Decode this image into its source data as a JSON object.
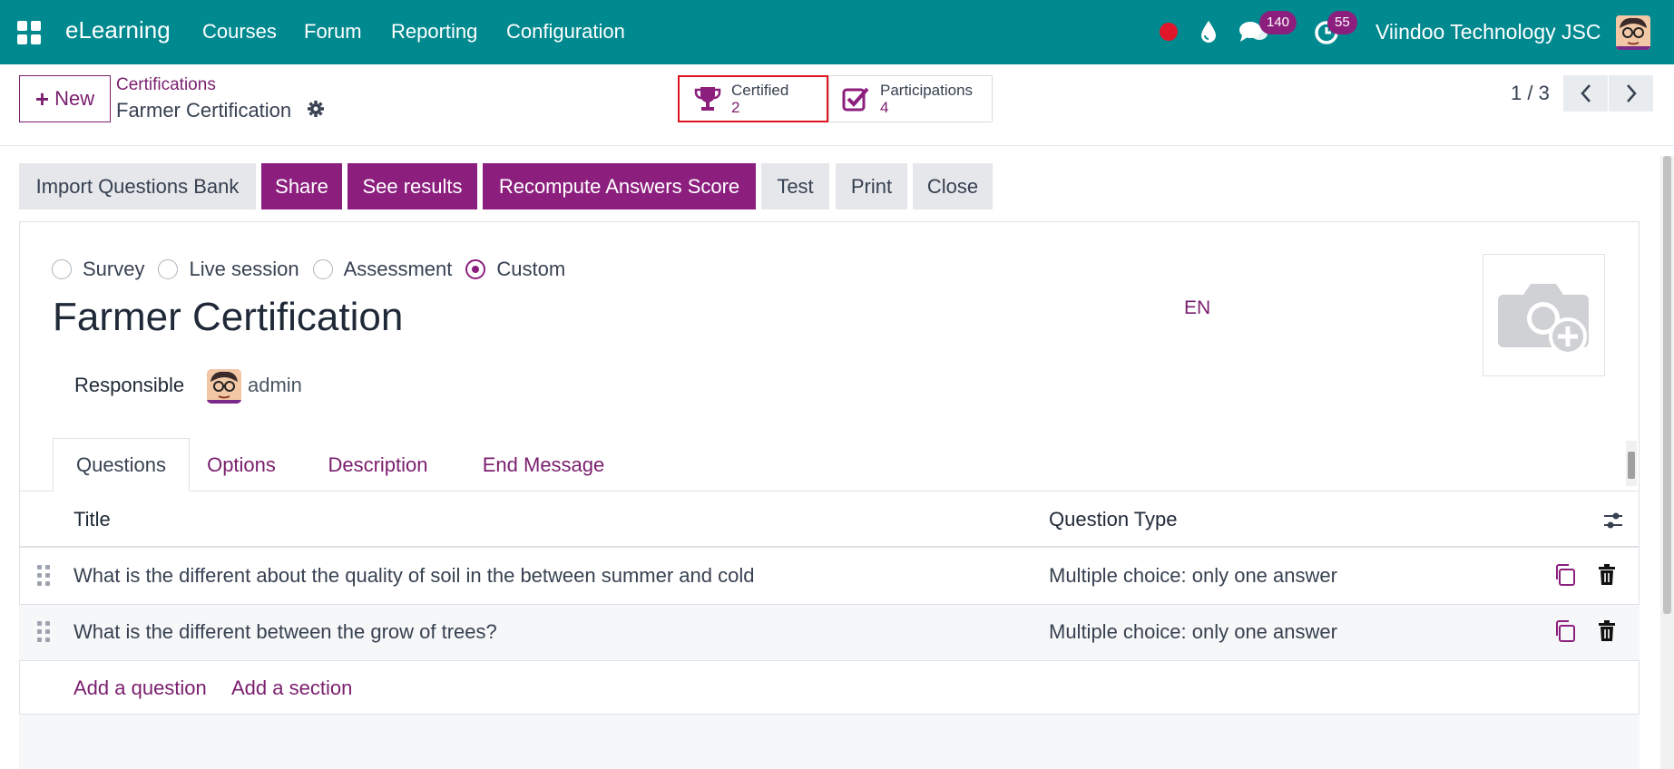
{
  "navbar": {
    "app_name": "eLearning",
    "menu": [
      "Courses",
      "Forum",
      "Reporting",
      "Configuration"
    ],
    "messages_count": "140",
    "activities_count": "55",
    "company": "Viindoo Technology JSC",
    "bg_color": "#00898f"
  },
  "control_panel": {
    "new_label": "New",
    "breadcrumb_parent": "Certifications",
    "breadcrumb_current": "Farmer Certification",
    "stat_certified": {
      "label": "Certified",
      "value": "2"
    },
    "stat_participations": {
      "label": "Participations",
      "value": "4"
    },
    "pager": "1 / 3"
  },
  "actions": [
    "Import Questions Bank",
    "Share",
    "See results",
    "Recompute Answers Score",
    "Test",
    "Print",
    "Close"
  ],
  "form": {
    "survey_types": [
      "Survey",
      "Live session",
      "Assessment",
      "Custom"
    ],
    "selected_type": "Custom",
    "title": "Farmer Certification",
    "lang": "EN",
    "responsible_label": "Responsible",
    "responsible_name": "admin"
  },
  "tabs": [
    "Questions",
    "Options",
    "Description",
    "End Message"
  ],
  "table": {
    "headers": [
      "Title",
      "Question Type"
    ],
    "rows": [
      {
        "title": "What is the different about the quality of soil in the between summer and cold",
        "type": "Multiple choice: only one answer"
      },
      {
        "title": "What is the different between the grow of trees?",
        "type": "Multiple choice: only one answer"
      }
    ],
    "add_question": "Add a question",
    "add_section": "Add a section"
  },
  "colors": {
    "brand": "#00898f",
    "accent": "#8c1f7e",
    "highlight": "#e0141e"
  }
}
